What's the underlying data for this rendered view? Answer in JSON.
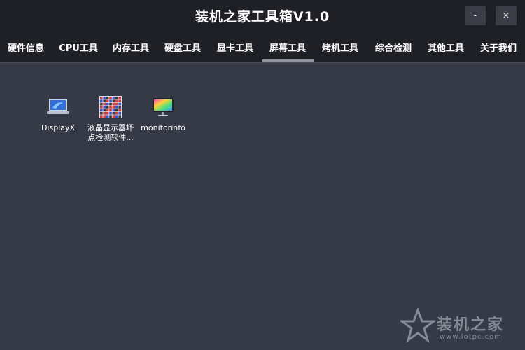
{
  "window": {
    "title": "装机之家工具箱V1.0",
    "minimize_label": "-",
    "close_label": "×"
  },
  "tabs": [
    {
      "label": "硬件信息"
    },
    {
      "label": "CPU工具"
    },
    {
      "label": "内存工具"
    },
    {
      "label": "硬盘工具"
    },
    {
      "label": "显卡工具"
    },
    {
      "label": "屏幕工具",
      "active": true
    },
    {
      "label": "烤机工具"
    },
    {
      "label": "综合检测"
    },
    {
      "label": "其他工具"
    },
    {
      "label": "关于我们"
    }
  ],
  "apps": [
    {
      "label": "DisplayX",
      "icon": "laptop-icon"
    },
    {
      "label": "液晶显示器坏点检测软件...",
      "icon": "pixel-grid-icon"
    },
    {
      "label": "monitorinfo",
      "icon": "monitor-icon"
    }
  ],
  "watermark": {
    "text": "装机之家",
    "url": "www.lotpc.com"
  },
  "colors": {
    "background": "#353a46",
    "titlebar": "#1e2026",
    "tab_indicator": "#8f949e"
  }
}
